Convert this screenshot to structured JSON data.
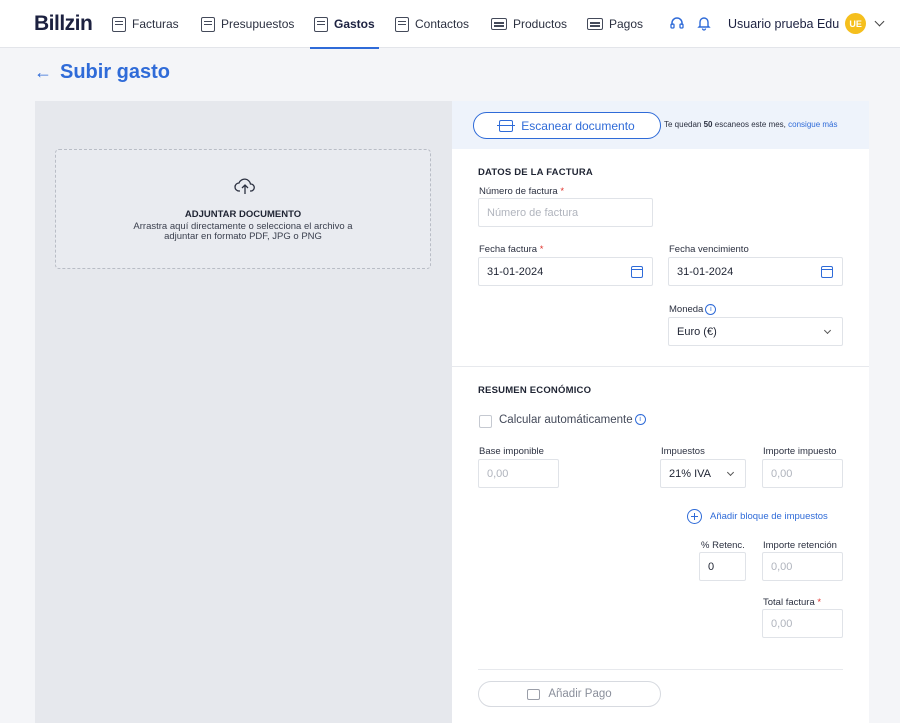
{
  "app": {
    "logo": "Billzin"
  },
  "nav": {
    "items": [
      {
        "label": "Facturas",
        "icon": "invoice-icon"
      },
      {
        "label": "Presupuestos",
        "icon": "quote-icon"
      },
      {
        "label": "Gastos",
        "icon": "expense-icon",
        "active": true
      },
      {
        "label": "Contactos",
        "icon": "contacts-icon"
      },
      {
        "label": "Productos",
        "icon": "products-icon"
      },
      {
        "label": "Pagos",
        "icon": "payments-icon"
      }
    ],
    "user_name": "Usuario prueba Edu",
    "user_initials": "UE"
  },
  "page": {
    "title": "Subir gasto"
  },
  "upload": {
    "title": "ADJUNTAR DOCUMENTO",
    "description": "Arrastra aquí directamente o selecciona el archivo a adjuntar en formato PDF, JPG o PNG"
  },
  "scan": {
    "button_label": "Escanear documento",
    "note_prefix": "Te quedan",
    "note_count": "50",
    "note_suffix": "escaneos este mes,",
    "note_link": "consigue más"
  },
  "invoice": {
    "section_title": "DATOS DE LA FACTURA",
    "number_label": "Número de factura",
    "number_placeholder": "Número de factura",
    "date_label": "Fecha factura",
    "date_value": "31-01-2024",
    "due_label": "Fecha vencimiento",
    "due_value": "31-01-2024",
    "currency_label": "Moneda",
    "currency_value": "Euro (€)"
  },
  "summary": {
    "section_title": "RESUMEN ECONÓMICO",
    "auto_calc_label": "Calcular automáticamente",
    "base_label": "Base imponible",
    "base_placeholder": "0,00",
    "tax_label": "Impuestos",
    "tax_value": "21% IVA",
    "tax_amount_label": "Importe impuesto",
    "tax_amount_placeholder": "0,00",
    "add_tax_label": "Añadir bloque de impuestos",
    "retention_label": "% Retenc.",
    "retention_value": "0",
    "retention_amount_label": "Importe retención",
    "retention_amount_placeholder": "0,00",
    "total_label": "Total factura",
    "total_placeholder": "0,00"
  },
  "payment": {
    "button_label": "Añadir Pago"
  },
  "colors": {
    "accent": "#2f6bd8",
    "required": "#e0322b",
    "avatar": "#f5bf1d"
  }
}
